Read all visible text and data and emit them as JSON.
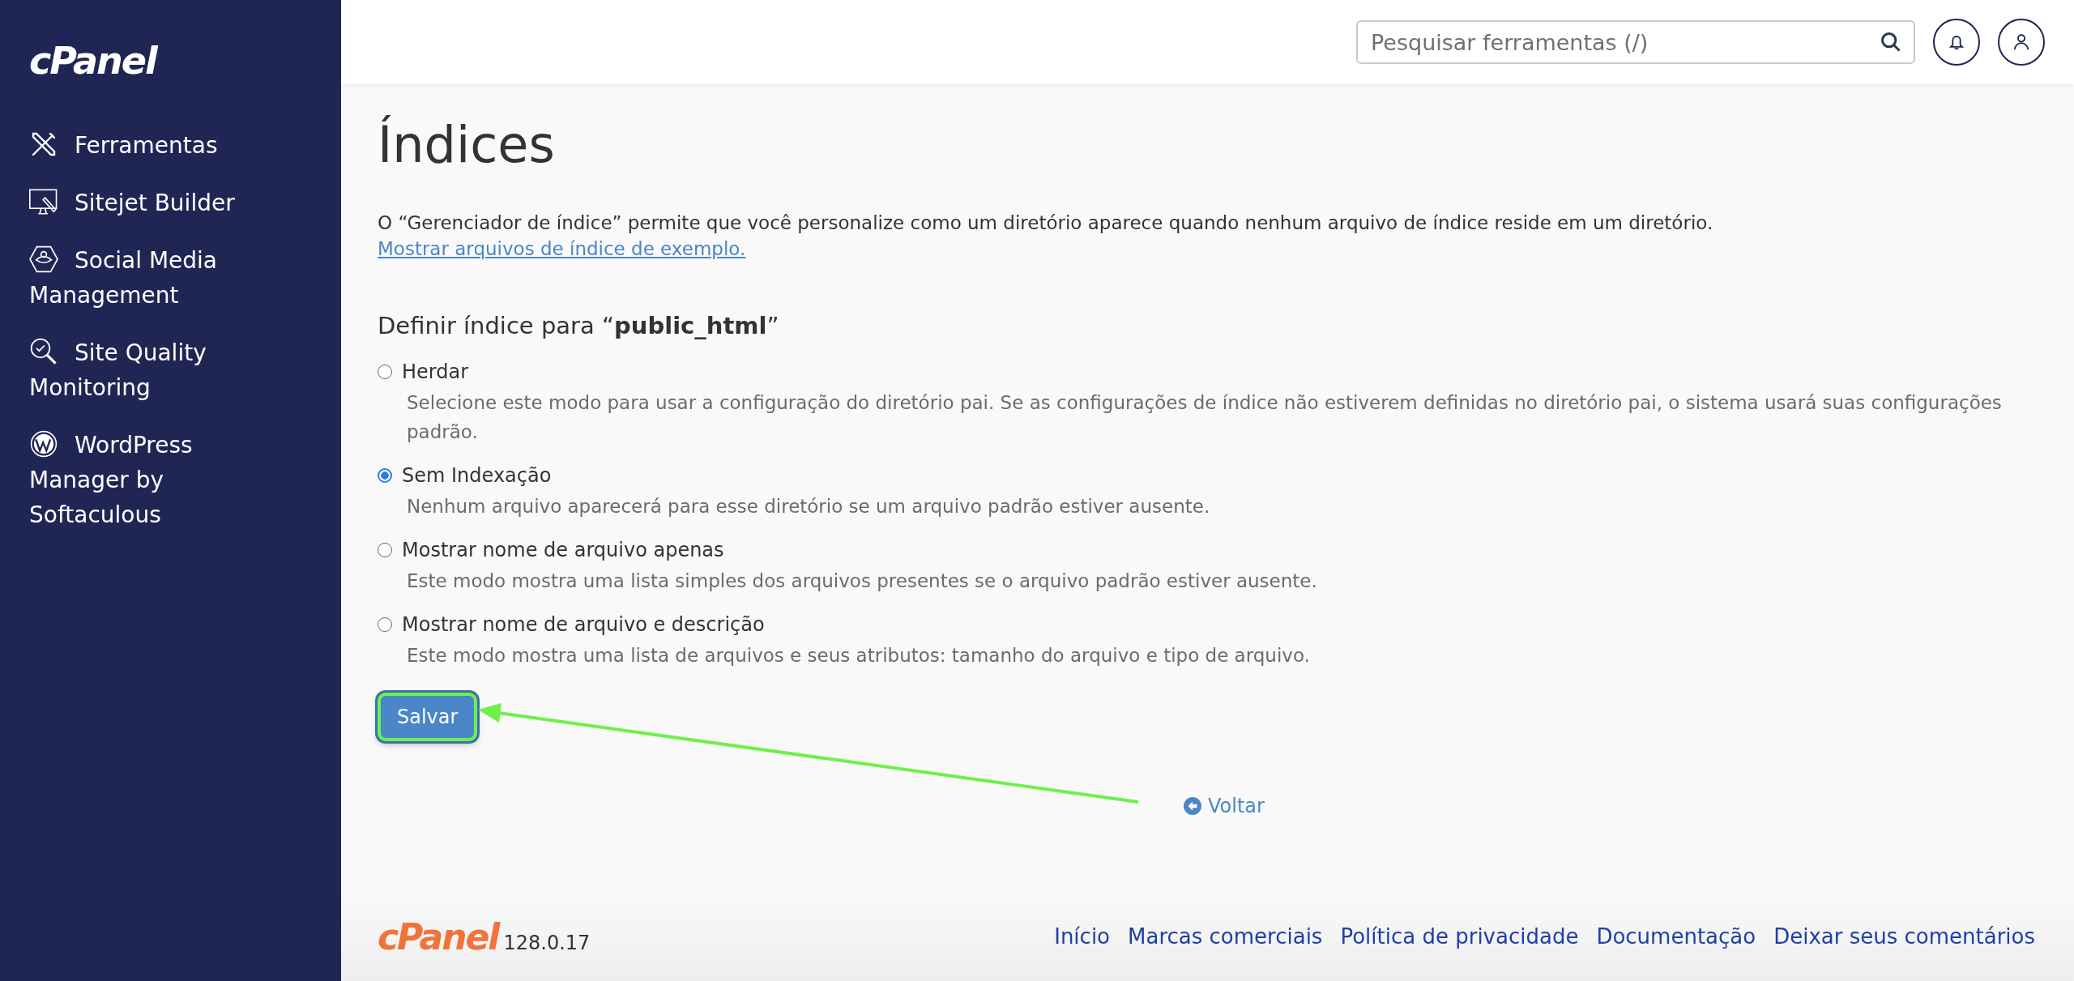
{
  "sidebar": {
    "logo": "cPanel",
    "items": [
      {
        "kind": "tools",
        "label": "Ferramentas"
      },
      {
        "kind": "builder",
        "label": "Sitejet Builder"
      },
      {
        "kind": "social",
        "label": "Social Media Management"
      },
      {
        "kind": "quality",
        "label": "Site Quality Monitoring"
      },
      {
        "kind": "wordpress",
        "label": "WordPress Manager by Softaculous"
      }
    ]
  },
  "topbar": {
    "search": {
      "placeholder": "Pesquisar ferramentas (/)"
    }
  },
  "page": {
    "title": "Índices",
    "description": "O “Gerenciador de índice” permite que você personalize como um diretório aparece quando nenhum arquivo de índice reside em um diretório.",
    "description_link": "Mostrar arquivos de índice de exemplo.",
    "section_title": "Definir índice para “**public_html**”",
    "options": [
      {
        "label": "Herdar",
        "description": "Selecione este modo para usar a configuração do diretório pai. Se as configurações de índice não estiverem definidas no diretório pai, o sistema usará suas configurações padrão.",
        "selected": false
      },
      {
        "label": "Sem Indexação",
        "description": "Nenhum arquivo aparecerá para esse diretório se um arquivo padrão estiver ausente.",
        "selected": true
      },
      {
        "label": "Mostrar nome de arquivo apenas",
        "description": "Este modo mostra uma lista simples dos arquivos presentes se o arquivo padrão estiver ausente.",
        "selected": false
      },
      {
        "label": "Mostrar nome de arquivo e descrição",
        "description": "Este modo mostra uma lista de arquivos e seus atributos: tamanho do arquivo e tipo de arquivo.",
        "selected": false
      }
    ],
    "save_button": "Salvar",
    "back_link": "Voltar"
  },
  "footer": {
    "logo": "cPanel",
    "version": "128.0.17",
    "links": [
      "Início",
      "Marcas comerciais",
      "Política de privacidade",
      "Documentação",
      "Deixar seus comentários"
    ]
  }
}
